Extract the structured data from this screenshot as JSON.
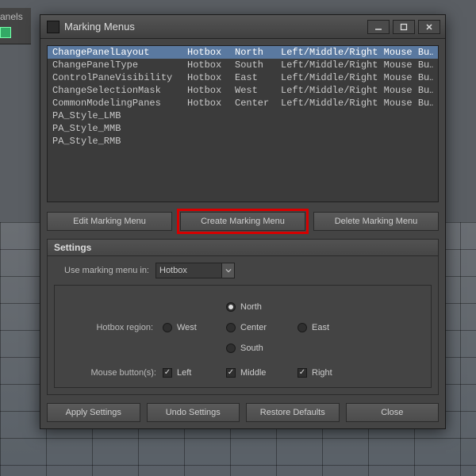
{
  "background_panel_label": "anels",
  "window": {
    "title": "Marking Menus"
  },
  "list": {
    "rows": [
      {
        "name": "ChangePanelLayout",
        "zone": "Hotbox",
        "dir": "North",
        "mouse": "Left/Middle/Right Mouse Bu…",
        "selected": true
      },
      {
        "name": "ChangePanelType",
        "zone": "Hotbox",
        "dir": "South",
        "mouse": "Left/Middle/Right Mouse Bu…",
        "selected": false
      },
      {
        "name": "ControlPaneVisibility",
        "zone": "Hotbox",
        "dir": "East",
        "mouse": "Left/Middle/Right Mouse Bu…",
        "selected": false
      },
      {
        "name": "ChangeSelectionMask",
        "zone": "Hotbox",
        "dir": "West",
        "mouse": "Left/Middle/Right Mouse Bu…",
        "selected": false
      },
      {
        "name": "CommonModelingPanes",
        "zone": "Hotbox",
        "dir": "Center",
        "mouse": "Left/Middle/Right Mouse Bu…",
        "selected": false
      },
      {
        "name": "PA_Style_LMB",
        "zone": "",
        "dir": "",
        "mouse": "",
        "selected": false
      },
      {
        "name": "PA_Style_MMB",
        "zone": "",
        "dir": "",
        "mouse": "",
        "selected": false
      },
      {
        "name": "PA_Style_RMB",
        "zone": "",
        "dir": "",
        "mouse": "",
        "selected": false
      }
    ]
  },
  "buttons": {
    "edit": "Edit Marking Menu",
    "create": "Create Marking Menu",
    "delete": "Delete Marking Menu"
  },
  "settings": {
    "header": "Settings",
    "use_label": "Use marking menu in:",
    "dropdown_value": "Hotbox",
    "region_label": "Hotbox region:",
    "region_options": {
      "north": "North",
      "west": "West",
      "center": "Center",
      "east": "East",
      "south": "South"
    },
    "region_selected": "North",
    "mouse_label": "Mouse button(s):",
    "mouse": {
      "left": "Left",
      "middle": "Middle",
      "right": "Right"
    },
    "mouse_checked": {
      "left": true,
      "middle": true,
      "right": true
    }
  },
  "footer": {
    "apply": "Apply Settings",
    "undo": "Undo Settings",
    "restore": "Restore Defaults",
    "close": "Close"
  },
  "colors": {
    "highlight": "#d60000",
    "selection": "#5a79a0"
  }
}
